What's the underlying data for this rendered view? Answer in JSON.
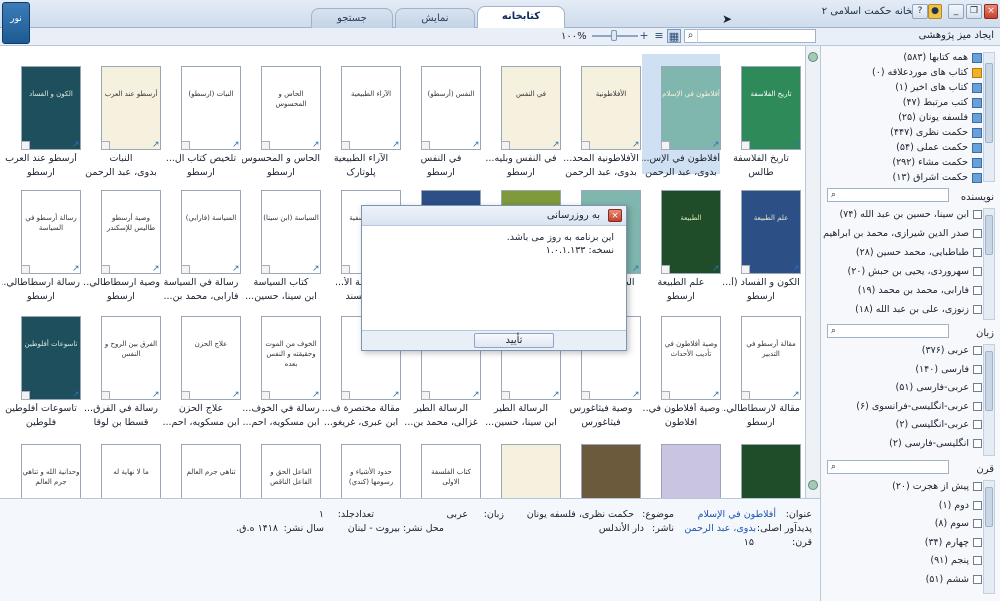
{
  "window": {
    "title": "کتابخانه حکمت اسلامی ۲",
    "logo_glyph": "نور"
  },
  "tabs": [
    {
      "label": "کتابخانه",
      "active": true
    },
    {
      "label": "نمایش",
      "active": false
    },
    {
      "label": "جستجو",
      "active": false
    }
  ],
  "toolbar": {
    "zoom": "۱۰۰%",
    "research_label": "ایجاد میز پژوهشی",
    "search_value": ""
  },
  "books": [
    {
      "title": "تاريخ الفلاسفة",
      "author": "طالس",
      "cover_text": "تاريخ الفلاسفة",
      "style": "c-green",
      "selected": false
    },
    {
      "title": "أفلاطون في الإس...",
      "author": "بدوی، عبد الرحمن",
      "cover_text": "أفلاطون في الإسلام",
      "style": "c-teal",
      "selected": true
    },
    {
      "title": "الأفلاطونية المحد...",
      "author": "بدوی، عبد الرحمن",
      "cover_text": "الأفلاطونية",
      "style": "c-cream",
      "selected": false
    },
    {
      "title": "في النفس وبليه...",
      "author": "ارسطو",
      "cover_text": "في النفس",
      "style": "c-cream",
      "selected": false
    },
    {
      "title": "في النفس",
      "author": "ارسطو",
      "cover_text": "النفس (أرسطو)",
      "style": "",
      "selected": false
    },
    {
      "title": "الآراء الطبيعية",
      "author": "پلوتارک",
      "cover_text": "الآراء الطبيعية",
      "style": "",
      "selected": false
    },
    {
      "title": "الحاس و المحسوس",
      "author": "ارسطو",
      "cover_text": "الحاس و المحسوس",
      "style": "",
      "selected": false
    },
    {
      "title": "تلخيص كتاب ال...",
      "author": "ارسطو",
      "cover_text": "النبات (ارسطو)",
      "style": "",
      "selected": false
    },
    {
      "title": "النبات",
      "author": "بدوی، عبد الرحمن",
      "cover_text": "أرسطو عند العرب",
      "style": "c-cream",
      "selected": false
    },
    {
      "title": "أرسطو عند العرب",
      "author": "ارسطو",
      "cover_text": "الكون و الفساد",
      "style": "c-darkteal",
      "selected": false
    },
    {
      "title": "الكون و الفساد (أ...",
      "author": "ارسطو",
      "cover_text": "علم الطبيعة",
      "style": "c-blue",
      "selected": false
    },
    {
      "title": "علم الطبيعة",
      "author": "ارسطو",
      "cover_text": "الطبيعة",
      "style": "c-darkgreen",
      "selected": false
    },
    {
      "title": "الطبيعة (أرسطو)",
      "author": "ار",
      "cover_text": "",
      "style": "c-teal",
      "selected": false
    },
    {
      "title": "ال",
      "author": "",
      "cover_text": "",
      "style": "c-olive",
      "selected": false
    },
    {
      "title": "",
      "author": "",
      "cover_text": "",
      "style": "c-blue",
      "selected": false
    },
    {
      "title": "الفلسفة الأ...",
      "author": "...بیسند",
      "cover_text": "مقالات فلسفية",
      "style": "",
      "selected": false
    },
    {
      "title": "كتاب السياسة",
      "author": "ابن سینا، حسین...",
      "cover_text": "السياسة (ابن سينا)",
      "style": "",
      "selected": false
    },
    {
      "title": "رسالة في السياسة",
      "author": "فارابی، محمد بن...",
      "cover_text": "السياسة (فارابي)",
      "style": "",
      "selected": false
    },
    {
      "title": "وصية ارسطاطالي...",
      "author": "ارسطو",
      "cover_text": "وصية أرسطو طاليس للإسكندر",
      "style": "",
      "selected": false
    },
    {
      "title": "رسالة ارسطاطالي...",
      "author": "ارسطو",
      "cover_text": "رسالة أرسطو في السياسة",
      "style": "",
      "selected": false
    },
    {
      "title": "مقالة لارسطاطالي...",
      "author": "ارسطو",
      "cover_text": "مقالة أرسطو في التدبير",
      "style": "",
      "selected": false
    },
    {
      "title": "وصية أفلاطون في...",
      "author": "افلاطون",
      "cover_text": "وصية أفلاطون في تأديب الأحداث",
      "style": "",
      "selected": false
    },
    {
      "title": "وصية فيثاغورس",
      "author": "فیثاغورس",
      "cover_text": "",
      "style": "",
      "selected": false
    },
    {
      "title": "الرسالة الطير",
      "author": "ابن سینا، حسین...",
      "cover_text": "",
      "style": "",
      "selected": false
    },
    {
      "title": "الرسالة الطير",
      "author": "غزالی، محمد بن...",
      "cover_text": "",
      "style": "",
      "selected": false
    },
    {
      "title": "مقالة مختصرة ف...",
      "author": "ابن عبری، غریغو...",
      "cover_text": "",
      "style": "",
      "selected": false
    },
    {
      "title": "رسالة في الخوف...",
      "author": "ابن مسکویه، احم...",
      "cover_text": "الخوف من الموت وحقيقته و النفس بعده",
      "style": "",
      "selected": false
    },
    {
      "title": "علاج الحزن",
      "author": "ابن مسکویه، احم...",
      "cover_text": "علاج الحزن",
      "style": "",
      "selected": false
    },
    {
      "title": "رسالة في الفرق...",
      "author": "قسطا بن لوقا",
      "cover_text": "الفرق بين الروح و النفس",
      "style": "",
      "selected": false
    },
    {
      "title": "تاسوعات أفلوطين",
      "author": "فلوطین",
      "cover_text": "تاسوعات أفلوطين",
      "style": "c-darkteal",
      "selected": false
    },
    {
      "title": "",
      "author": "",
      "cover_text": "",
      "style": "c-darkgreen",
      "selected": false
    },
    {
      "title": "",
      "author": "",
      "cover_text": "",
      "style": "c-lavender",
      "selected": false
    },
    {
      "title": "",
      "author": "",
      "cover_text": "",
      "style": "c-brown",
      "selected": false
    },
    {
      "title": "",
      "author": "",
      "cover_text": "",
      "style": "c-cream",
      "selected": false
    },
    {
      "title": "",
      "author": "",
      "cover_text": "كتاب الفلسفة الاولى",
      "style": "",
      "selected": false
    },
    {
      "title": "",
      "author": "",
      "cover_text": "حدود الأشياء و رسومها (كندي)",
      "style": "",
      "selected": false
    },
    {
      "title": "",
      "author": "",
      "cover_text": "الفاعل الحق و الفاعل الناقص",
      "style": "",
      "selected": false
    },
    {
      "title": "",
      "author": "",
      "cover_text": "تناهي جرم العالم",
      "style": "",
      "selected": false
    },
    {
      "title": "",
      "author": "",
      "cover_text": "ما لا نهاية له",
      "style": "",
      "selected": false
    },
    {
      "title": "",
      "author": "",
      "cover_text": "وحدانية الله و تناهي جرم العالم",
      "style": "",
      "selected": false
    }
  ],
  "details": {
    "title_label": "عنوان:",
    "title_value": "أفلاطون في الإسلام",
    "subject_label": "موضوع:",
    "subject_value": "حکمت نظری، فلسفه یونان",
    "lang_label": "زبان:",
    "lang_value": "عربی",
    "creator_label": "پدیدآور اصلی:",
    "creator_value": "بدوی، عبد الرحمن",
    "publisher_label": "ناشر:",
    "publisher_value": "دار الأندلس",
    "place_label": "محل نشر:",
    "place_value": "بیروت - لبنان",
    "year_label": "سال نشر:",
    "year_value": "۱۴۱۸ ه.ق.",
    "volumes_label": "تعدادجلد:",
    "volumes_value": "۱",
    "century_label": "قرن:",
    "century_value": "۱۵"
  },
  "sidebar": {
    "categories": [
      {
        "label": "همه کتابها (۵۸۳)",
        "icon": "book-icon"
      },
      {
        "label": "کتاب های موردعلاقه (۰)",
        "icon": "star-icon"
      },
      {
        "label": "کتاب های اخیر (۱)",
        "icon": "book-icon"
      },
      {
        "label": "کتب مرتبط (۴۷)",
        "icon": "book-icon"
      },
      {
        "label": "فلسفه یونان (۲۵)",
        "icon": "book-icon"
      },
      {
        "label": "حکمت نظری (۴۴۷)",
        "icon": "book-icon"
      },
      {
        "label": "حکمت عملی (۵۴)",
        "icon": "book-icon"
      },
      {
        "label": "حکمت مشاء (۲۹۲)",
        "icon": "book-icon"
      },
      {
        "label": "حکمت اشراق (۱۳)",
        "icon": "book-icon"
      }
    ],
    "author_header": "نویسنده",
    "authors": [
      "ابن سینا، حسین بن عبد الله (۷۴)",
      "صدر الدین شیرازی، محمد بن ابراهیم",
      "طباطبایی، محمد حسین (۲۸)",
      "سهروردی، یحیی بن حبش (۲۰)",
      "فارابی، محمد بن محمد (۱۹)",
      "زنوزی، علی بن عبد الله (۱۸)"
    ],
    "lang_header": "زبان",
    "languages": [
      "عربی (۳۷۶)",
      "فارسی (۱۴۰)",
      "عربی-فارسی (۵۱)",
      "عربی-انگلیسی-فرانسوی (۶)",
      "عربی-انگلیسی (۲)",
      "انگلیسی-فارسی (۲)"
    ],
    "century_header": "قرن",
    "centuries": [
      "پیش از هجرت (۲۰)",
      "دوم (۱)",
      "سوم (۸)",
      "چهارم (۳۴)",
      "پنجم (۹۱)",
      "ششم (۵۱)"
    ]
  },
  "dialog": {
    "title": "به روزرسانی",
    "message": "این برنامه به روز می باشد.",
    "version": "نسخه: ۱.۰.۱.۱۳۳",
    "ok": "تأیید"
  }
}
